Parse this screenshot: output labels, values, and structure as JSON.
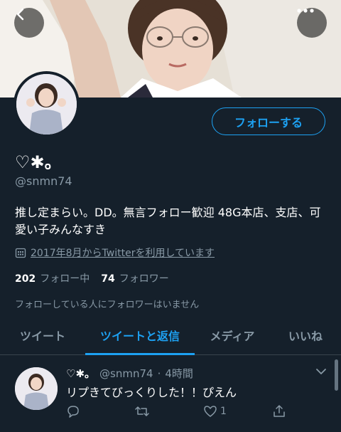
{
  "header": {
    "back_icon": "chevron-left-icon",
    "more_icon": "ellipsis-icon"
  },
  "profile": {
    "display_name": "♡✱。",
    "handle": "@snmn74",
    "follow_label": "フォローする",
    "bio": "推し定まらい。DD。無言フォロー歓迎 48G本店、支店、可愛い子みんなすき",
    "joined": "2017年8月からTwitterを利用しています",
    "following_count": "202",
    "following_label": "フォロー中",
    "followers_count": "74",
    "followers_label": "フォロワー",
    "no_mutual": "フォローしている人にフォロワーはいません"
  },
  "tabs": [
    {
      "label": "ツイート"
    },
    {
      "label": "ツイートと返信"
    },
    {
      "label": "メディア"
    },
    {
      "label": "いいね"
    }
  ],
  "tweet": {
    "name": "♡✱。",
    "handle": "@snmn74",
    "separator": "·",
    "time": "4時間",
    "text": "リプきてびっくりした！！ぴえん",
    "like_count": "1"
  },
  "colors": {
    "background": "#15202b",
    "accent": "#1da1f2",
    "muted": "#8899a6",
    "divider": "#38444d"
  }
}
